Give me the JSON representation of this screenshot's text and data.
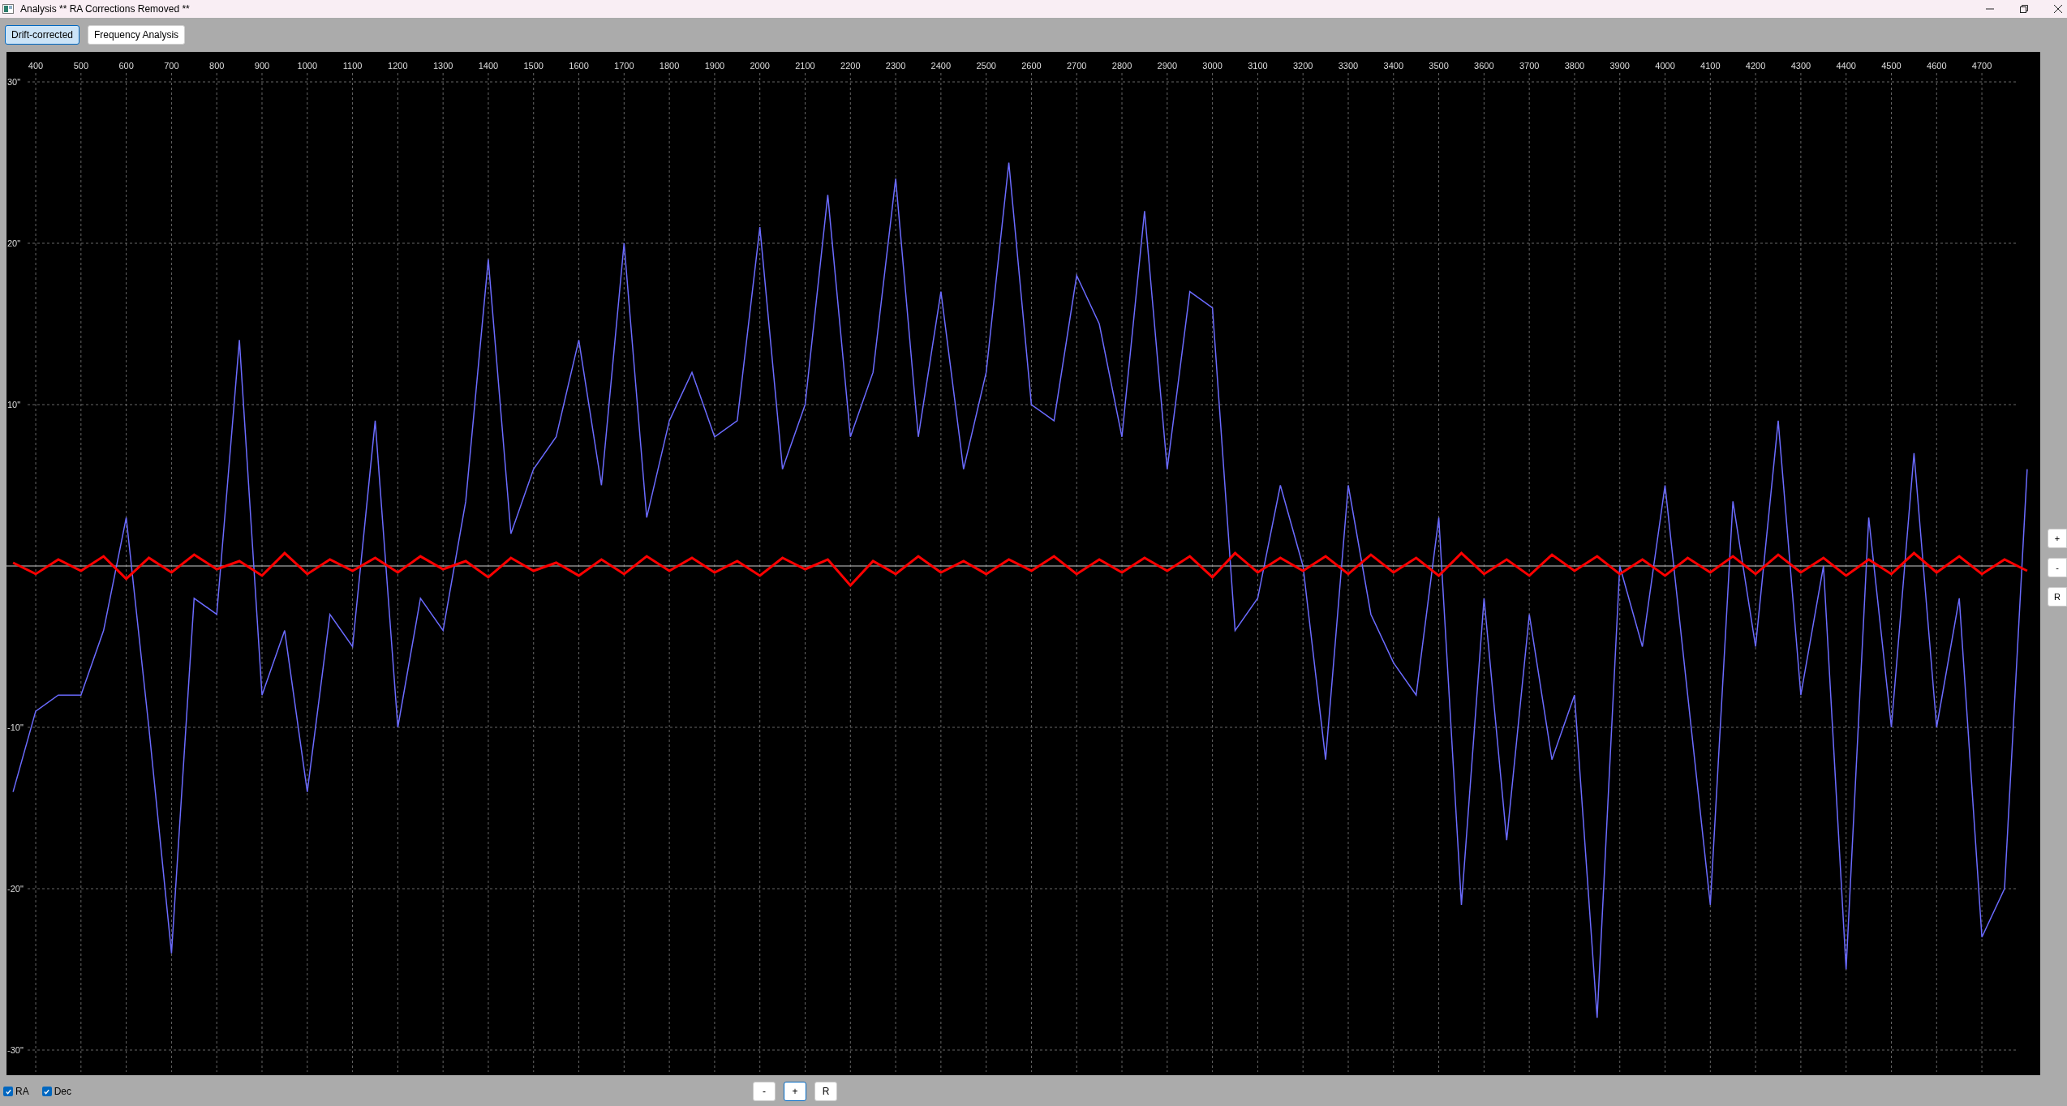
{
  "window": {
    "title": "Analysis ** RA Corrections Removed **"
  },
  "tabs": [
    {
      "label": "Drift-corrected",
      "selected": true
    },
    {
      "label": "Frequency Analysis",
      "selected": false
    }
  ],
  "side_buttons": [
    "+",
    "-",
    "R"
  ],
  "chart": {
    "chart_data": {
      "type": "line",
      "x": [
        350,
        400,
        450,
        500,
        550,
        600,
        650,
        700,
        750,
        800,
        850,
        900,
        950,
        1000,
        1050,
        1100,
        1150,
        1200,
        1250,
        1300,
        1350,
        1400,
        1450,
        1500,
        1550,
        1600,
        1650,
        1700,
        1750,
        1800,
        1850,
        1900,
        1950,
        2000,
        2050,
        2100,
        2150,
        2200,
        2250,
        2300,
        2350,
        2400,
        2450,
        2500,
        2550,
        2600,
        2650,
        2700,
        2750,
        2800,
        2850,
        2900,
        2950,
        3000,
        3050,
        3100,
        3150,
        3200,
        3250,
        3300,
        3350,
        3400,
        3450,
        3500,
        3550,
        3600,
        3650,
        3700,
        3750,
        3800,
        3850,
        3900,
        3950,
        4000,
        4050,
        4100,
        4150,
        4200,
        4250,
        4300,
        4350,
        4400,
        4450,
        4500,
        4550,
        4600,
        4650,
        4700,
        4750,
        4800
      ],
      "xticks": [
        400,
        500,
        600,
        700,
        800,
        900,
        1000,
        1100,
        1200,
        1300,
        1400,
        1500,
        1600,
        1700,
        1800,
        1900,
        2000,
        2100,
        2200,
        2300,
        2400,
        2500,
        2600,
        2700,
        2800,
        2900,
        3000,
        3100,
        3200,
        3300,
        3400,
        3500,
        3600,
        3700,
        3800,
        3900,
        4000,
        4100,
        4200,
        4300,
        4400,
        4500,
        4600,
        4700
      ],
      "yticks": [
        {
          "value": 30,
          "label": "30\""
        },
        {
          "value": 20,
          "label": "20\""
        },
        {
          "value": 10,
          "label": "10\""
        },
        {
          "value": -10,
          "label": "-10\""
        },
        {
          "value": -20,
          "label": "-20\""
        },
        {
          "value": -30,
          "label": "-30\""
        }
      ],
      "ylim": [
        -30,
        30
      ],
      "xlim": [
        339,
        4811
      ],
      "grid": true,
      "ref_lines": [
        {
          "axis": "y",
          "value": 0
        }
      ],
      "series": [
        {
          "name": "RA",
          "color": "#6b6bff",
          "values": [
            -14,
            -9,
            -8,
            -8,
            -4,
            3,
            -10,
            -24,
            -2,
            -3,
            14,
            -8,
            -4,
            -14,
            -3,
            -5,
            9,
            -10,
            -2,
            -4,
            4,
            19,
            2,
            6,
            8,
            14,
            5,
            20,
            3,
            9,
            12,
            8,
            9,
            21,
            6,
            10,
            23,
            8,
            12,
            24,
            8,
            17,
            6,
            12,
            25,
            10,
            9,
            18,
            15,
            8,
            22,
            6,
            17,
            16,
            -4,
            -2,
            5,
            0,
            -12,
            5,
            -3,
            -6,
            -8,
            3,
            -21,
            -2,
            -17,
            -3,
            -12,
            -8,
            -28,
            0,
            -5,
            5,
            -8,
            -21,
            4,
            -5,
            9,
            -8,
            0,
            -25,
            3,
            -10,
            7,
            -10,
            -2,
            -23,
            -20,
            6
          ]
        },
        {
          "name": "Dec",
          "color": "#ff0000",
          "values": [
            0.2,
            -0.5,
            0.4,
            -0.3,
            0.6,
            -0.8,
            0.5,
            -0.4,
            0.7,
            -0.2,
            0.3,
            -0.6,
            0.8,
            -0.5,
            0.4,
            -0.3,
            0.5,
            -0.4,
            0.6,
            -0.2,
            0.3,
            -0.7,
            0.5,
            -0.3,
            0.2,
            -0.6,
            0.4,
            -0.5,
            0.6,
            -0.3,
            0.5,
            -0.4,
            0.3,
            -0.6,
            0.5,
            -0.2,
            0.4,
            -1.2,
            0.3,
            -0.5,
            0.6,
            -0.4,
            0.3,
            -0.5,
            0.4,
            -0.3,
            0.6,
            -0.5,
            0.4,
            -0.4,
            0.5,
            -0.3,
            0.6,
            -0.7,
            0.8,
            -0.4,
            0.5,
            -0.3,
            0.6,
            -0.5,
            0.7,
            -0.4,
            0.5,
            -0.6,
            0.8,
            -0.5,
            0.4,
            -0.6,
            0.7,
            -0.3,
            0.6,
            -0.5,
            0.4,
            -0.6,
            0.5,
            -0.4,
            0.6,
            -0.5,
            0.7,
            -0.4,
            0.5,
            -0.6,
            0.4,
            -0.5,
            0.8,
            -0.4,
            0.6,
            -0.5,
            0.4,
            -0.3
          ]
        }
      ]
    }
  },
  "legend": [
    {
      "checked": true
    },
    {
      "checked": true
    }
  ],
  "bottom_buttons": [
    "-",
    "+",
    "R"
  ]
}
